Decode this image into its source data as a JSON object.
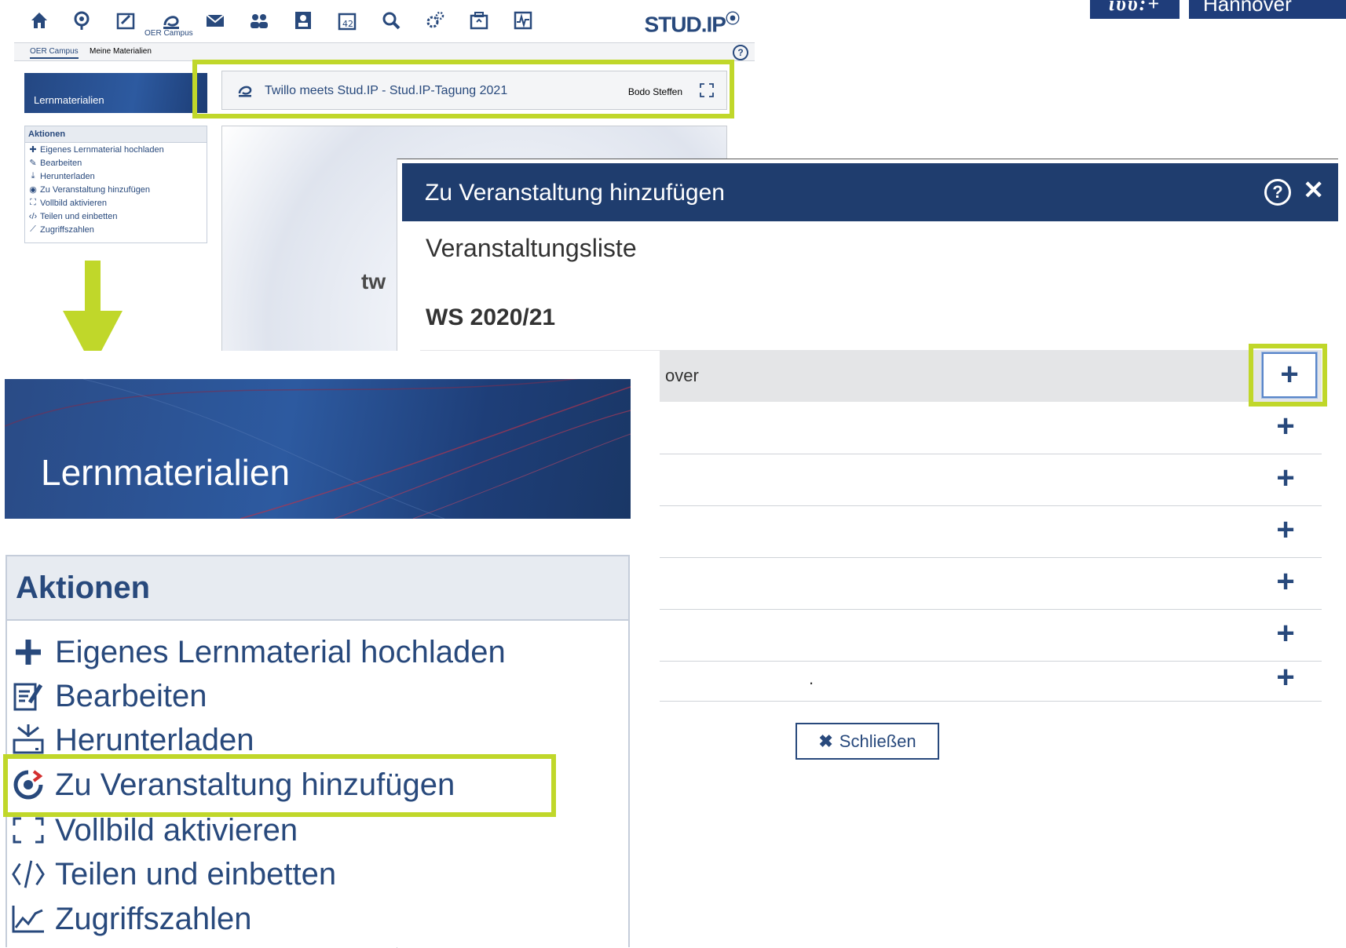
{
  "logos": {
    "luh": "ιυυ:+",
    "city": "Hannover"
  },
  "studip_small": {
    "nav": {
      "icons": [
        "home-icon",
        "activity-icon",
        "courses-icon",
        "oer-campus-icon",
        "mail-icon",
        "community-icon",
        "profile-icon",
        "calendar-icon",
        "search-icon",
        "tools-icon",
        "admin-icon",
        "stats-icon"
      ],
      "active_label": "OER Campus",
      "brand": "STUD.IP"
    },
    "tabs": [
      "OER Campus",
      "Meine Materialien"
    ],
    "sidebar": {
      "banner_title": "Lernmaterialien",
      "actions_title": "Aktionen",
      "actions": [
        {
          "icon": "plus-icon",
          "label": "Eigenes Lernmaterial hochladen"
        },
        {
          "icon": "edit-icon",
          "label": "Bearbeiten"
        },
        {
          "icon": "download-icon",
          "label": "Herunterladen"
        },
        {
          "icon": "add-to-course-icon",
          "label": "Zu Veranstaltung hinzufügen"
        },
        {
          "icon": "fullscreen-icon",
          "label": "Vollbild aktivieren"
        },
        {
          "icon": "embed-icon",
          "label": "Teilen und einbetten"
        },
        {
          "icon": "stats-icon",
          "label": "Zugriffszahlen"
        }
      ]
    },
    "material": {
      "title": "Twillo meets Stud.IP - Stud.IP-Tagung 2021",
      "author": "Bodo Steffen",
      "preview_text": "tw"
    }
  },
  "modal": {
    "title": "Zu Veranstaltung hinzufügen",
    "list_title": "Veranstaltungsliste",
    "semester": "WS 2020/21",
    "rows": [
      {
        "text": "over",
        "highlighted": true
      },
      {
        "text": ""
      },
      {
        "text": ""
      },
      {
        "text": ""
      },
      {
        "text": ""
      },
      {
        "text": ""
      },
      {
        "text": "."
      }
    ],
    "close_label": "Schließen"
  },
  "zoom_sidebar": {
    "banner_title": "Lernmaterialien",
    "actions_title": "Aktionen",
    "actions": [
      {
        "icon": "plus-icon",
        "label": "Eigenes Lernmaterial hochladen"
      },
      {
        "icon": "edit-icon",
        "label": "Bearbeiten"
      },
      {
        "icon": "download-icon",
        "label": "Herunterladen"
      },
      {
        "icon": "add-to-course-icon",
        "label": "Zu Veranstaltung hinzufügen"
      },
      {
        "icon": "fullscreen-icon",
        "label": "Vollbild aktivieren"
      },
      {
        "icon": "embed-icon",
        "label": "Teilen und einbetten"
      },
      {
        "icon": "stats-icon",
        "label": "Zugriffszahlen"
      }
    ]
  },
  "colors": {
    "primary": "#28497c",
    "highlight": "#c0d72a",
    "modal_bar": "#1f3d6e"
  }
}
